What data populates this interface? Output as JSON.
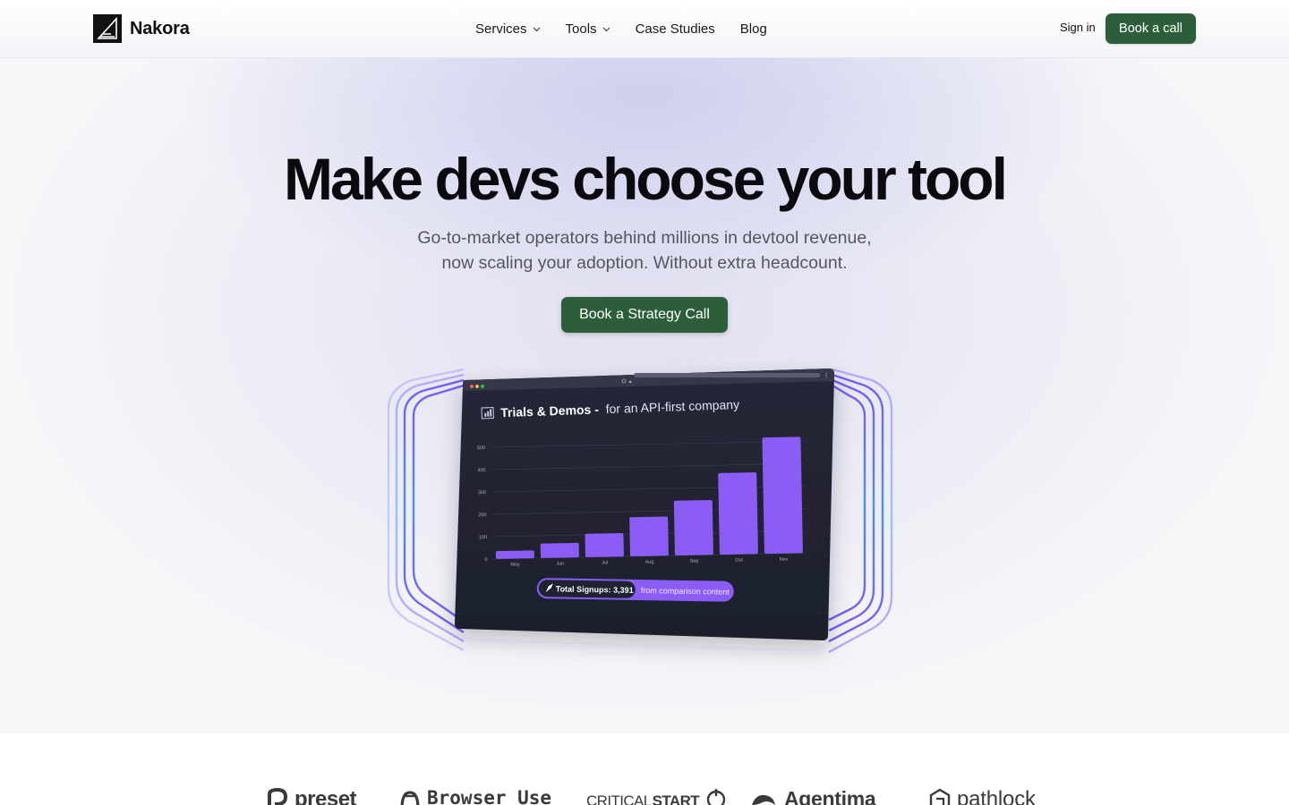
{
  "header": {
    "brand": "Nakora",
    "nav": [
      {
        "label": "Services",
        "has_dropdown": true
      },
      {
        "label": "Tools",
        "has_dropdown": true
      },
      {
        "label": "Case Studies",
        "has_dropdown": false
      },
      {
        "label": "Blog",
        "has_dropdown": false
      }
    ],
    "sign_in": "Sign in",
    "cta": "Book a call"
  },
  "hero": {
    "title": "Make devs choose your tool",
    "subtitle_line1": "Go-to-market operators behind millions in devtool revenue,",
    "subtitle_line2": "now scaling your adoption. Without extra headcount.",
    "cta": "Book a Strategy Call"
  },
  "chart_card": {
    "title_bold": "Trials & Demos -",
    "title_rest": "for an API-first company",
    "badge_value": "Total Signups: 3,391",
    "badge_note": "from comparison content"
  },
  "chart_data": {
    "type": "bar",
    "title": "Trials & Demos - for an API-first company",
    "categories": [
      "May",
      "Jun",
      "Jul",
      "Aug",
      "Sep",
      "Oct",
      "Nov"
    ],
    "values": [
      35,
      65,
      105,
      175,
      245,
      365,
      520
    ],
    "yticks": [
      0,
      100,
      200,
      300,
      400,
      500
    ],
    "ylim": [
      0,
      520
    ],
    "xlabel": "",
    "ylabel": "",
    "grid": true,
    "bar_color": "#8b5cf6"
  },
  "logos": [
    {
      "name": "preset",
      "text": "preset"
    },
    {
      "name": "browser-use",
      "text": "Browser Use"
    },
    {
      "name": "critical-start",
      "text_light": "CRITICAL",
      "text_bold": "START"
    },
    {
      "name": "agentima",
      "text": "Agentima"
    },
    {
      "name": "pathlock",
      "text": "pathlock"
    }
  ],
  "colors": {
    "brand_green": "#2d5e3a",
    "chart_bg": "#1f2230",
    "bar_purple": "#8b5cf6",
    "ring_purple": "#7c5cf0",
    "ring_blue": "#4d8ef5"
  }
}
